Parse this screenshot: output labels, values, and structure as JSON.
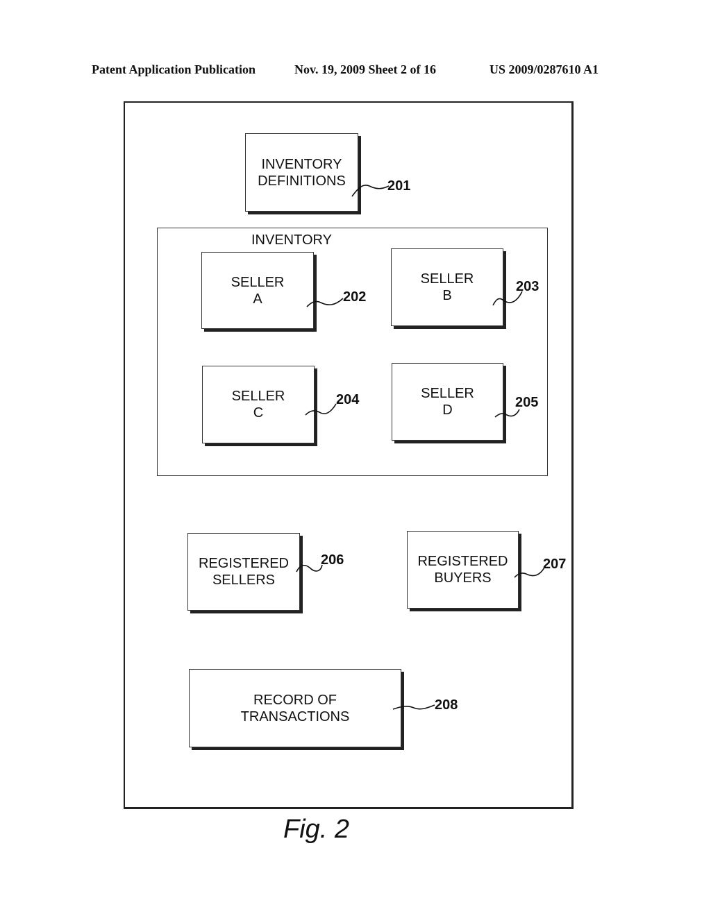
{
  "header": {
    "publication": "Patent Application Publication",
    "date_sheet": "Nov. 19, 2009   Sheet 2 of 16",
    "pub_number": "US 2009/0287610 A1"
  },
  "diagram": {
    "inventory_definitions": {
      "label": "INVENTORY\nDEFINITIONS",
      "ref": "201"
    },
    "inventory_group": {
      "label": "INVENTORY",
      "sellers": [
        {
          "label": "SELLER\nA",
          "ref": "202"
        },
        {
          "label": "SELLER\nB",
          "ref": "203"
        },
        {
          "label": "SELLER\nC",
          "ref": "204"
        },
        {
          "label": "SELLER\nD",
          "ref": "205"
        }
      ]
    },
    "registered_sellers": {
      "label": "REGISTERED\nSELLERS",
      "ref": "206"
    },
    "registered_buyers": {
      "label": "REGISTERED\nBUYERS",
      "ref": "207"
    },
    "record_of_transactions": {
      "label": "RECORD OF\nTRANSACTIONS",
      "ref": "208"
    }
  },
  "caption": "Fig. 2"
}
